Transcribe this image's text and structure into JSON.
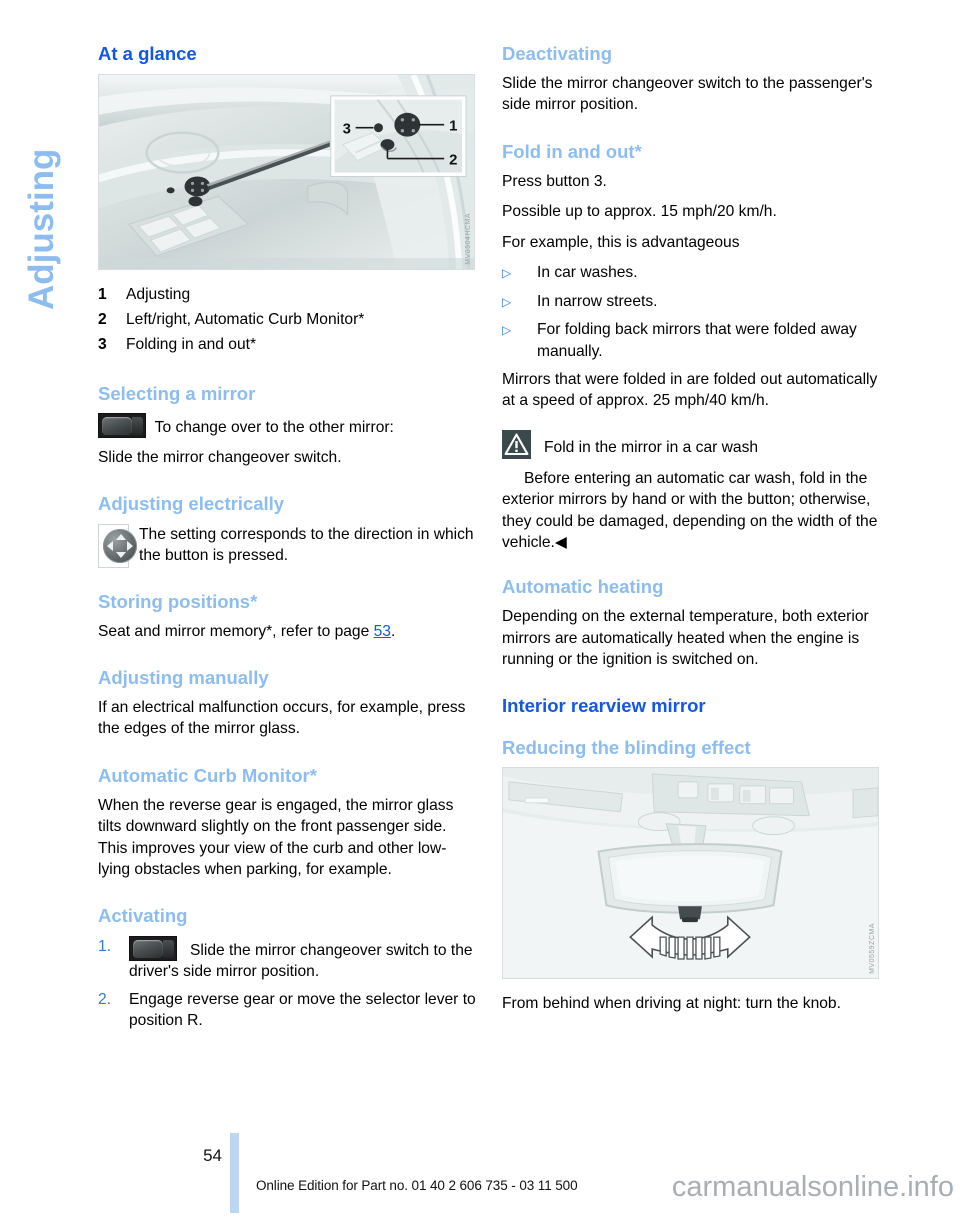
{
  "side_tab": {
    "label": "Adjusting"
  },
  "left_column": {
    "heading_at_a_glance": "At a glance",
    "figure_top": {
      "id": "MV0504HCMA",
      "callouts": [
        "3",
        "1",
        "2"
      ]
    },
    "legend": [
      {
        "num": "1",
        "text": "Adjusting"
      },
      {
        "num": "2",
        "text": "Left/right, Automatic Curb Monitor*"
      },
      {
        "num": "3",
        "text": "Folding in and out*"
      }
    ],
    "heading_selecting_a_mirror": "Selecting a mirror",
    "selecting_line1": "To change over to the other mirror:",
    "selecting_line2": "Slide the mirror changeover switch.",
    "heading_adjusting_electrically": "Adjusting electrically",
    "adjusting_electrically_text": "The setting corresponds to the direction in which the button is pressed.",
    "heading_storing_positions": "Storing positions*",
    "storing_positions_text_a": "Seat and mirror memory*, refer to page ",
    "storing_positions_page": "53",
    "storing_positions_text_b": ".",
    "heading_adjusting_manually": "Adjusting manually",
    "adjusting_manually_text": "If an electrical malfunction occurs, for example, press the edges of the mirror glass.",
    "heading_automatic_curb_monitor": "Automatic Curb Monitor*",
    "automatic_curb_monitor_text": "When the reverse gear is engaged, the mirror glass tilts downward slightly on the front passenger side. This improves your view of the curb and other low-lying obstacles when parking, for example.",
    "heading_activating": "Activating",
    "steps": [
      {
        "num": "1.",
        "text": "Slide the mirror changeover switch to the driver's side mirror position."
      },
      {
        "num": "2.",
        "text": "Engage reverse gear or move the selector lever to position R."
      }
    ]
  },
  "right_column": {
    "heading_deactivating": "Deactivating",
    "deactivating_text": "Slide the mirror changeover switch to the passenger's side mirror position.",
    "heading_fold_in_and_out": "Fold in and out*",
    "fold_line1": "Press button 3.",
    "fold_line2": "Possible up to approx. 15 mph/20 km/h.",
    "fold_line3": "For example, this is advantageous",
    "fold_bullets": [
      "In car washes.",
      "In narrow streets.",
      "For folding back mirrors that were folded away manually."
    ],
    "fold_line4": "Mirrors that were folded in are folded out automatically at a speed of approx. 25 mph/40 km/h.",
    "warning_title": "Fold in the mirror in a car wash",
    "warning_body": "Before entering an automatic car wash, fold in the exterior mirrors by hand or with the button; otherwise, they could be damaged, depending on the width of the vehicle.◀",
    "heading_automatic_heating": "Automatic heating",
    "automatic_heating_text": "Depending on the external temperature, both exterior mirrors are automatically heated when the engine is running or the ignition is switched on.",
    "heading_interior_rearview_mirror": "Interior rearview mirror",
    "heading_reducing_blinding": "Reducing the blinding effect",
    "figure_bottom": {
      "id": "MV0559ZCMA"
    },
    "figure_caption": "From behind when driving at night: turn the knob."
  },
  "footer": {
    "page_number": "54",
    "edition_text": "Online Edition for Part no. 01 40 2 606 735 - 03 11 500",
    "watermark": "carmanualsonline.info"
  },
  "colors": {
    "major_heading": "#1157E8",
    "minor_heading": "#8DBDF0",
    "side_tab": "#8DBDF0",
    "footer_bar": "#BDD7F2",
    "bullet_marker": "#2F7BE0"
  }
}
